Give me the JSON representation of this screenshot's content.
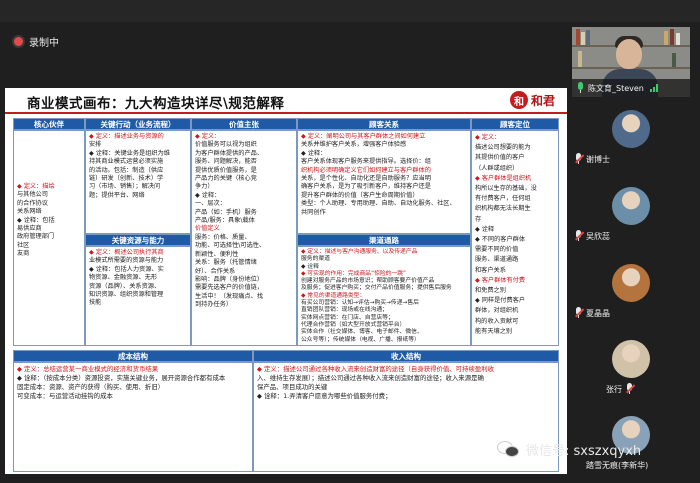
{
  "meeting": {
    "recording_label": "录制中"
  },
  "slide": {
    "title": "商业模式画布：九大构造块详尽\\规范解释",
    "brand_seal": "和",
    "brand_name": "和君",
    "columns": {
      "partners": {
        "header": "核心伙伴",
        "lines": [
          "◆ 定义：描绘",
          "与其他公司",
          "的合作协议",
          "关系网络",
          "◆ 诠释：包括",
          "易供应商",
          "政府管理部门",
          "社区",
          "友商"
        ]
      },
      "activities": {
        "header": "关键行动（业务流程）",
        "lines": [
          "◆ 定义：描述业务与资源的",
          "安排",
          "◆ 诠释：关键业务是组织为维",
          "持其商业模式运营必须实施",
          "的活动。包括：制造（供应",
          "链）研发（创新、技术）学",
          "习（市场、销售）；解决问",
          "题；提供平台、网络"
        ]
      },
      "resources": {
        "header": "关键资源与能力",
        "lines": [
          "◆ 定义：概述公司执行其商",
          "业模式所需要的资源与能力",
          "◆ 诠释：包括人力资源、实",
          "物资源、金融资源、无形",
          "资源（品牌）、关系资源、",
          "知识资源、组织资源和管理",
          "技能"
        ]
      },
      "value": {
        "header": "价值主张",
        "lines": [
          "◆ 定义：",
          "价值服务可以视为组织",
          "为客户群体提供的产品、",
          "服务、问题解决，能否",
          "提供优质价值服务，是",
          "产品力的关键（核心竞",
          "争力）",
          "◆ 诠释：",
          "一、层次：",
          "产品（如：手机）服务",
          "产品/服务：具象\\载体",
          "价值定义",
          "服务：价格、质量、",
          "功能、可选择性\\可选性、",
          "新颖性、便利性",
          "关系：服务（托管情绪",
          "好）、合作关系",
          "影响：品牌（身份地位）",
          "需要先选客户的价值链，",
          "生活中！（发现痛点、找",
          "到持办任务）"
        ]
      },
      "relationships": {
        "header": "顾客关系",
        "lines": [
          "◆ 定义：阐明公司与其客户群体之间如何建立",
          "关系并维护客户关系，增强客户体验感",
          "◆ 诠释：",
          "客户关系体现客户服务来提供指导。选择价：组",
          "织机构必须明确定义它们如何建立与客户群体的",
          "关系，是个性化、自动化还是自助服务？应当明",
          "确客户关系，是为了吸引新客户，维持客户还是",
          "提升客户群体的价值（客户生命周期价值）",
          "类型：个人助理、专用助理、自助、自动化服务、社区、",
          "共同创作"
        ]
      },
      "channels": {
        "header": "渠道通路",
        "lines": [
          "◆ 定义：描述与客户沟通服务、以及传递产品",
          "服务的渠道",
          "◆ 诠释",
          "◆ 可实现的作用：完成商品“惊险的一跳”",
          "创建对服务产品的市场意识；帮助顾客要产价值产品",
          "及服务；促进客户购买；交付产品价值服务；提供售后服务",
          "◆ 常见的渠道通路类型：",
          "有买公司营销：认知→评估→购买→传递→售后",
          "直销团队营销：现场或在线沟通；",
          "实体网点营销：在门店、自营店等；",
          "代理合作营销（如大型开放式营销平台）",
          "实体合作（社交媒体、博客、电子邮件、微信、",
          "公众号等）；传统媒体（电视、广播、报纸等）"
        ]
      },
      "segments": {
        "header": "顾客定位",
        "lines": [
          "◆ 定义：",
          "描述公司想要的能为",
          "其提供价值的客户",
          "（人群或组织）",
          "◆ 客户群体是组织机",
          "构所以生存的基础，没",
          "有付费客户，任何组",
          "织机构都无法长期生",
          "存",
          "◆ 诠释",
          "◆ 不同的客户群体",
          "需要不同的价值",
          "服务、渠道通路",
          "和客户关系",
          "◆ 客户群体有付费",
          "和免费之别",
          "◆ 同样是付费客户",
          "群体，对组织机",
          "构的收入贡献可",
          "能有天壤之别"
        ]
      },
      "cost": {
        "header": "成本结构",
        "lines": [
          "◆ 定义：总结运营某一商业模式的经济和货币结果",
          "◆ 诠释：（按成本分类）资源投资，实施关键业务，展开资源合作都有成本",
          "固定成本：资源、资产的获得（购买、使用、折旧）",
          "可变成本：与运营活动挂钩的成本"
        ]
      },
      "revenue": {
        "header": "收入结构",
        "lines": [
          "◆ 定义：描述公司通过各种收入流来创造财富的途径（自身获得价值、可持续盈利收",
          "入、维持生存发展）；描述公司通过各种收入流来创造财富的途径；收入来源是确",
          "保产品、项目成功的关键",
          "◆ 诠释：1.弄清客户愿意为哪些价值服务付费；"
        ]
      }
    }
  },
  "video": {
    "main_speaker": "陈文育_Steven",
    "participants": [
      {
        "name": "谢博士",
        "avatar_color": "#4f6a8a"
      },
      {
        "name": "吴欣蕊",
        "avatar_color": "#6b8fa8"
      },
      {
        "name": "夏晶晶",
        "avatar_color": "#b5733e"
      },
      {
        "name": "张行",
        "avatar_color": "#cfc2a8"
      },
      {
        "name": "踏雪无痕(李新华)",
        "avatar_color": "#8aa2b8"
      }
    ]
  },
  "watermark": {
    "text": "微信号: sxszxqyxh"
  }
}
